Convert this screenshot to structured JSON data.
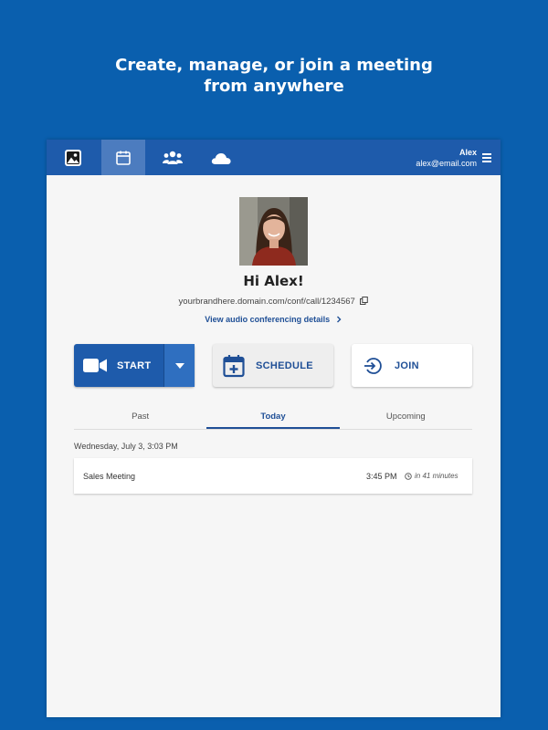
{
  "headline": {
    "line1": "Create, manage, or join a meeting",
    "line2": "from anywhere"
  },
  "user": {
    "name": "Alex",
    "email": "alex@email.com"
  },
  "nav": {
    "items": [
      {
        "icon": "image-icon"
      },
      {
        "icon": "calendar-icon",
        "active": true
      },
      {
        "icon": "contacts-icon"
      },
      {
        "icon": "cloud-icon"
      }
    ]
  },
  "profile": {
    "greeting": "Hi Alex!",
    "url": "yourbrandhere.domain.com/conf/call/1234567",
    "audio_link": "View audio conferencing details"
  },
  "actions": {
    "start": "START",
    "schedule": "SCHEDULE",
    "join": "JOIN"
  },
  "tabs": [
    {
      "label": "Past"
    },
    {
      "label": "Today",
      "active": true
    },
    {
      "label": "Upcoming"
    }
  ],
  "agenda": {
    "date": "Wednesday, July 3, 3:03 PM",
    "meetings": [
      {
        "title": "Sales Meeting",
        "time": "3:45 PM",
        "relative": "in 41 minutes"
      }
    ]
  },
  "colors": {
    "background": "#0a5fae",
    "topbar": "#1e5bab",
    "accent": "#1f4f96"
  }
}
